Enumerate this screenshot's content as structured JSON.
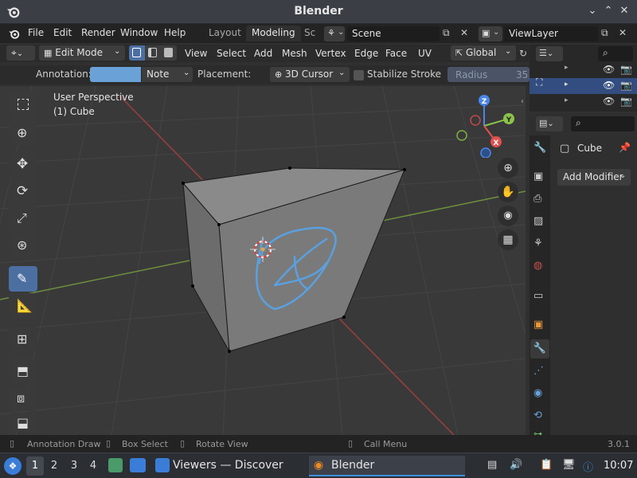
{
  "window": {
    "title": "Blender"
  },
  "menubar": {
    "items": [
      "File",
      "Edit",
      "Render",
      "Window",
      "Help"
    ],
    "tabs": [
      "Layout",
      "Modeling",
      "Sc"
    ],
    "active_tab": "Modeling",
    "scene": "Scene",
    "view_layer": "ViewLayer"
  },
  "header": {
    "mode": "Edit Mode",
    "menus": [
      "View",
      "Select",
      "Add",
      "Mesh",
      "Vertex",
      "Edge",
      "Face",
      "UV"
    ],
    "transform_orientation": "Global"
  },
  "tool_settings": {
    "annotation_label": "Annotation:",
    "annotation_color": "#6aa2d8",
    "annotation_layer": "Note",
    "placement_label": "Placement:",
    "placement_value": "3D Cursor",
    "stabilize_label": "Stabilize Stroke",
    "radius_label": "Radius",
    "radius_value": "35"
  },
  "viewport": {
    "perspective": "User Perspective",
    "object": "(1) Cube",
    "gizmo": {
      "x": "X",
      "y": "Y",
      "z": "Z"
    }
  },
  "properties": {
    "object_name": "Cube",
    "add_modifier": "Add Modifier"
  },
  "statusbar": {
    "items": [
      "Annotation Draw",
      "Box Select",
      "Rotate View",
      "Call Menu"
    ],
    "version": "3.0.1"
  },
  "taskbar": {
    "desktops": [
      "1",
      "2",
      "3",
      "4"
    ],
    "apps": [
      "Viewers — Discover",
      "Blender"
    ],
    "clock": "10:07"
  },
  "colors": {
    "accent": "#4c6fa2",
    "annotation_stroke": "#5aa0e0",
    "axis_x": "#e05050",
    "axis_y": "#8bc34a"
  }
}
